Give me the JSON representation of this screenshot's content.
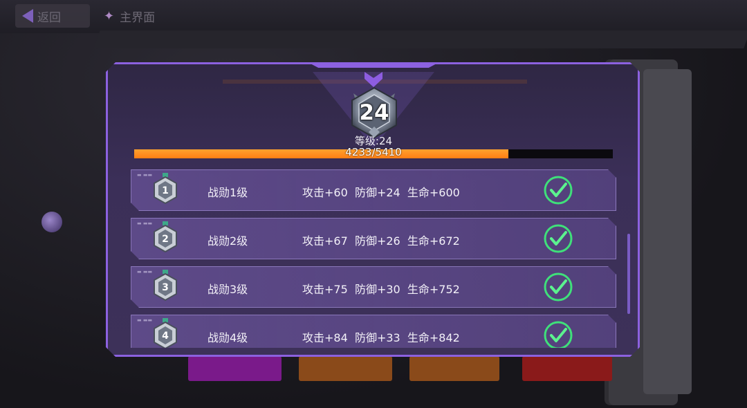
{
  "background": {
    "back_label": "返回",
    "main_label": "主界面"
  },
  "badge": {
    "level_number": "24",
    "level_text": "等级:24"
  },
  "progress": {
    "current": 4233,
    "max": 5410,
    "text": "4233/5410"
  },
  "rows": [
    {
      "rank": "1",
      "title": "战勋1级",
      "stats": "攻击+60  防御+24  生命+600",
      "completed": true
    },
    {
      "rank": "2",
      "title": "战勋2级",
      "stats": "攻击+67  防御+26  生命+672",
      "completed": true
    },
    {
      "rank": "3",
      "title": "战勋3级",
      "stats": "攻击+75  防御+30  生命+752",
      "completed": true
    },
    {
      "rank": "4",
      "title": "战勋4级",
      "stats": "攻击+84  防御+33  生命+842",
      "completed": true
    }
  ],
  "colors": {
    "panel_border": "#8c61e0",
    "progress_fill": "#ff8a1c",
    "check": "#3fe07a"
  },
  "icons": {
    "badge": "level-badge-icon",
    "medal": "medal-icon",
    "check": "check-circle-icon"
  }
}
